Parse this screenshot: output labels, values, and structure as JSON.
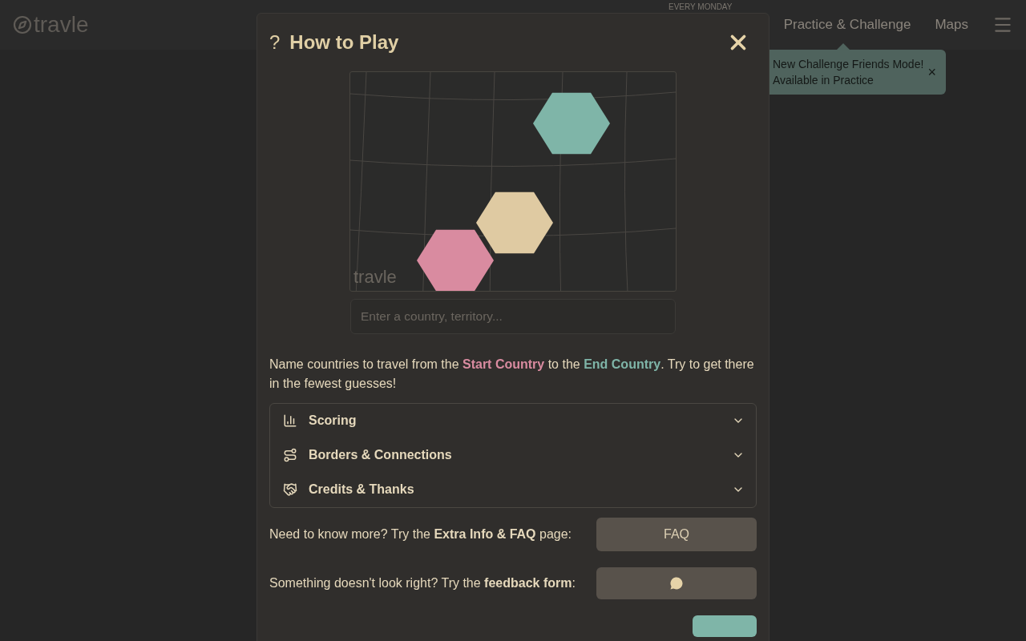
{
  "header": {
    "logo": "travle",
    "banner": "EVERY MONDAY",
    "nav": [
      "Practice & Challenge",
      "Maps"
    ]
  },
  "toast": {
    "lines": [
      "New Challenge Friends Mode!",
      "Available in Practice"
    ],
    "close": "×"
  },
  "modal": {
    "title": "How to Play",
    "help_mark": "?",
    "demo": {
      "watermark": "travle",
      "hexes": [
        {
          "color": "#7fb5a8"
        },
        {
          "color": "#dfcaa2"
        },
        {
          "color": "#d98ba0"
        }
      ]
    },
    "input": {
      "placeholder": "Enter a country, territory..."
    },
    "intro": [
      {
        "text": "Name countries to travel from the "
      },
      {
        "text": "Start Country",
        "color": "#d98ba0"
      },
      {
        "text": " to the "
      },
      {
        "text": "End Country",
        "color": "#7fb5a8"
      },
      {
        "text": ". Try to get there in the fewest guesses!"
      }
    ],
    "sections": [
      {
        "label": "Scoring",
        "kind": "chart",
        "expanded": false
      },
      {
        "label": "Borders & Connections",
        "kind": "route",
        "expanded": false
      },
      {
        "label": "Credits & Thanks",
        "kind": "handshake",
        "expanded": false
      }
    ],
    "faq": {
      "text": "Need to know more? Try the **Extra Info & FAQ** page:",
      "button": "FAQ"
    },
    "feedback": {
      "text": "Something doesn't look right? Try the **feedback form**:"
    }
  }
}
